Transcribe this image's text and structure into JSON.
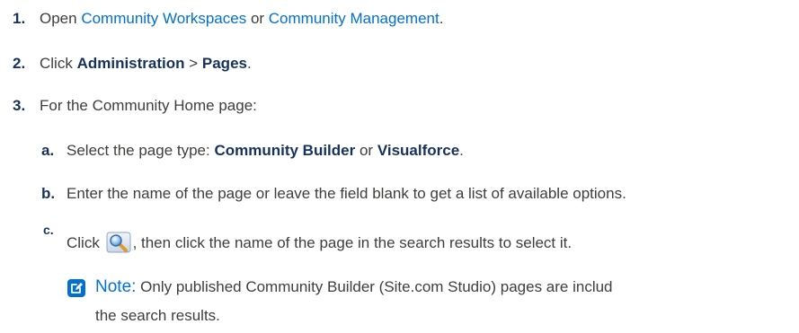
{
  "steps": [
    {
      "num": "1.",
      "open": "Open ",
      "link1": "Community Workspaces",
      "or": " or ",
      "link2": "Community Management",
      "end": "."
    },
    {
      "num": "2.",
      "click": "Click ",
      "b1": "Administration",
      "sep": " > ",
      "b2": "Pages",
      "end": "."
    },
    {
      "num": "3.",
      "text": "For the Community Home page:"
    }
  ],
  "substeps": [
    {
      "num": "a.",
      "pre": "Select the page type: ",
      "b1": "Community Builder",
      "or": " or ",
      "b2": "Visualforce",
      "end": "."
    },
    {
      "num": "b.",
      "text": "Enter the name of the page or leave the field blank to get a list of available options."
    },
    {
      "num": "c.",
      "pre": "Click ",
      "icon": "lookup-magnifier-icon",
      "post": ", then click the name of the page in the search results to select it."
    }
  ],
  "note": {
    "icon": "edit-note-icon",
    "label": "Note:",
    "text_line1": " Only published Community Builder (Site.com Studio) pages are includ",
    "text_line2": "the search results."
  },
  "colors": {
    "link": "#0070d2",
    "text": "#3e3e3c",
    "bold": "#16325c"
  }
}
